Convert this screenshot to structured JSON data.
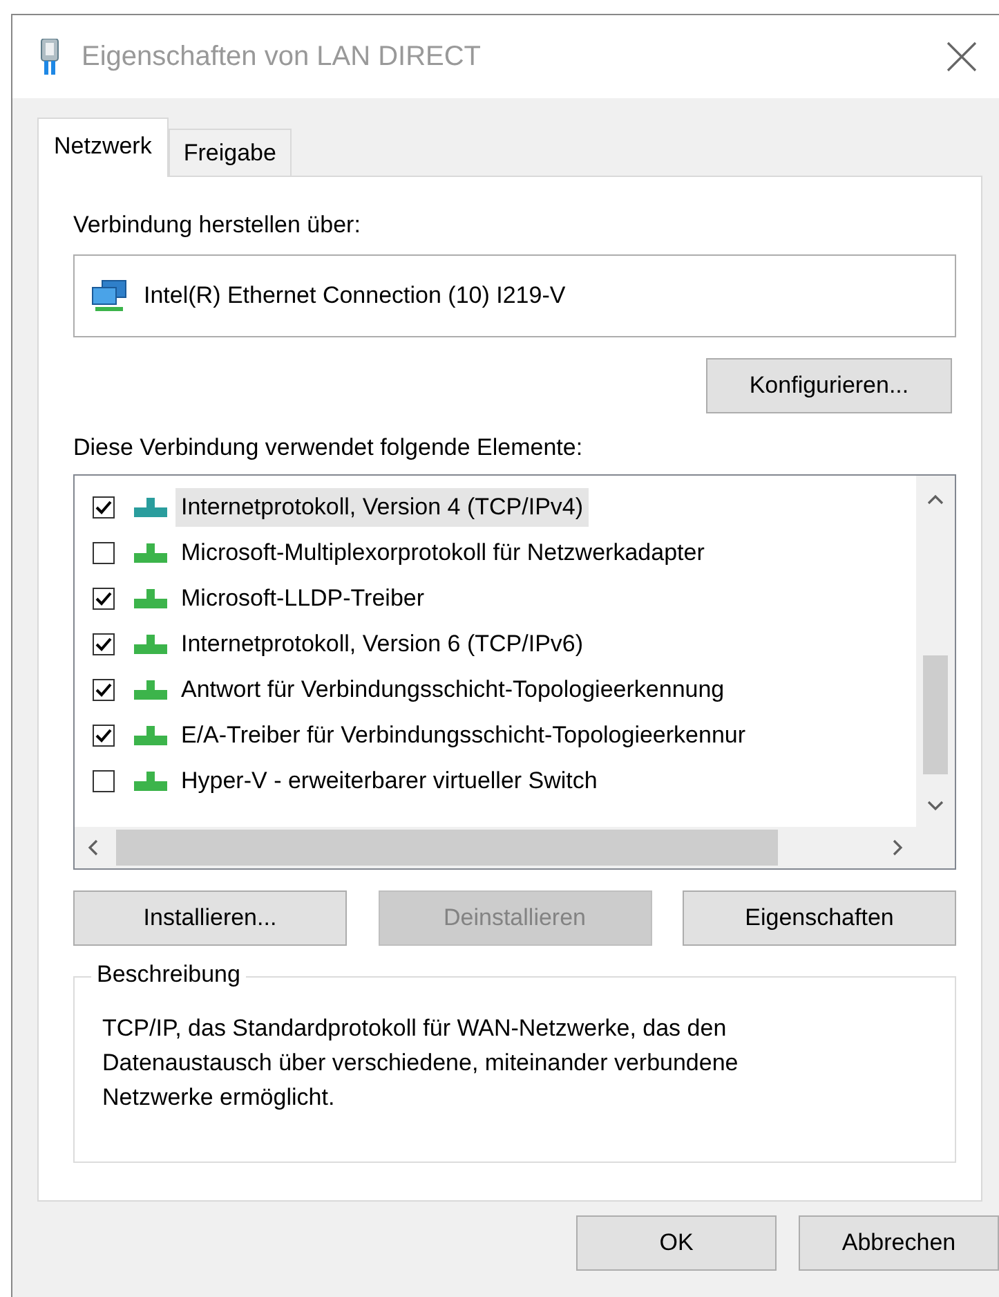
{
  "window": {
    "title": "Eigenschaften von LAN DIRECT"
  },
  "tabs": [
    {
      "label": "Netzwerk",
      "selected": true
    },
    {
      "label": "Freigabe",
      "selected": false
    }
  ],
  "connect_via": {
    "label": "Verbindung herstellen über:",
    "adapter": "Intel(R) Ethernet Connection (10) I219-V",
    "configure_button": "Konfigurieren..."
  },
  "components": {
    "label": "Diese Verbindung verwendet folgende Elemente:",
    "items": [
      {
        "label": "Internetprotokoll, Version 4 (TCP/IPv4)",
        "checked": true,
        "selected": true
      },
      {
        "label": "Microsoft-Multiplexorprotokoll für Netzwerkadapter",
        "checked": false,
        "selected": false
      },
      {
        "label": "Microsoft-LLDP-Treiber",
        "checked": true,
        "selected": false
      },
      {
        "label": "Internetprotokoll, Version 6 (TCP/IPv6)",
        "checked": true,
        "selected": false
      },
      {
        "label": "Antwort für Verbindungsschicht-Topologieerkennung",
        "checked": true,
        "selected": false
      },
      {
        "label": "E/A-Treiber für Verbindungsschicht-Topologieerkennur",
        "checked": true,
        "selected": false
      },
      {
        "label": "Hyper-V - erweiterbarer virtueller Switch",
        "checked": false,
        "selected": false
      }
    ]
  },
  "actions": [
    {
      "label": "Installieren...",
      "disabled": false
    },
    {
      "label": "Deinstallieren",
      "disabled": true
    },
    {
      "label": "Eigenschaften",
      "disabled": false
    }
  ],
  "description": {
    "legend": "Beschreibung",
    "text": "TCP/IP, das Standardprotokoll für WAN-Netzwerke, das den Datenaustausch über verschiedene, miteinander verbundene Netzwerke ermöglicht."
  },
  "buttons": [
    "OK",
    "Abbrechen"
  ]
}
